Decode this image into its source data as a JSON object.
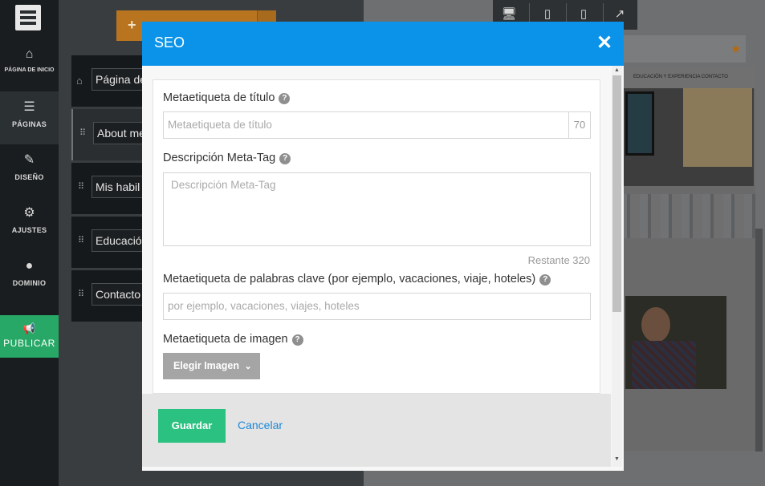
{
  "sidebar": {
    "items": [
      {
        "label": "PÁGINA DE INICIO",
        "icon": "home-icon"
      },
      {
        "label": "PÁGINAS",
        "icon": "pages-icon"
      },
      {
        "label": "DISEÑO",
        "icon": "brush-icon"
      },
      {
        "label": "AJUSTES",
        "icon": "gear-icon"
      },
      {
        "label": "DOMINIO",
        "icon": "globe-icon"
      }
    ],
    "publish_label": "PUBLICAR"
  },
  "pages": [
    {
      "name": "Página de"
    },
    {
      "name": "About me"
    },
    {
      "name": "Mis habil"
    },
    {
      "name": "Educación"
    },
    {
      "name": "Contacto"
    }
  ],
  "preview": {
    "nav_text": "EDUCACIÓN Y EXPERIENCIA   CONTACTO"
  },
  "modal": {
    "title": "SEO",
    "title_tag_label": "Metaetiqueta de título",
    "title_tag_placeholder": "Metaetiqueta de título",
    "title_tag_counter": "70",
    "description_label": "Descripción Meta-Tag",
    "description_placeholder": "Descripción Meta-Tag",
    "remaining_text": "Restante  320",
    "keywords_label": "Metaetiqueta de palabras clave (por ejemplo, vacaciones, viaje, hoteles)",
    "keywords_placeholder": "por ejemplo, vacaciones, viajes, hoteles",
    "image_label": "Metaetiqueta de imagen",
    "choose_image_label": "Elegir Imagen",
    "save_label": "Guardar",
    "cancel_label": "Cancelar"
  },
  "colors": {
    "modal_header": "#0a93e8",
    "save_button": "#2bc180",
    "publish": "#27a866",
    "add_button": "#b8741f",
    "cancel_link": "#1a88d6"
  }
}
